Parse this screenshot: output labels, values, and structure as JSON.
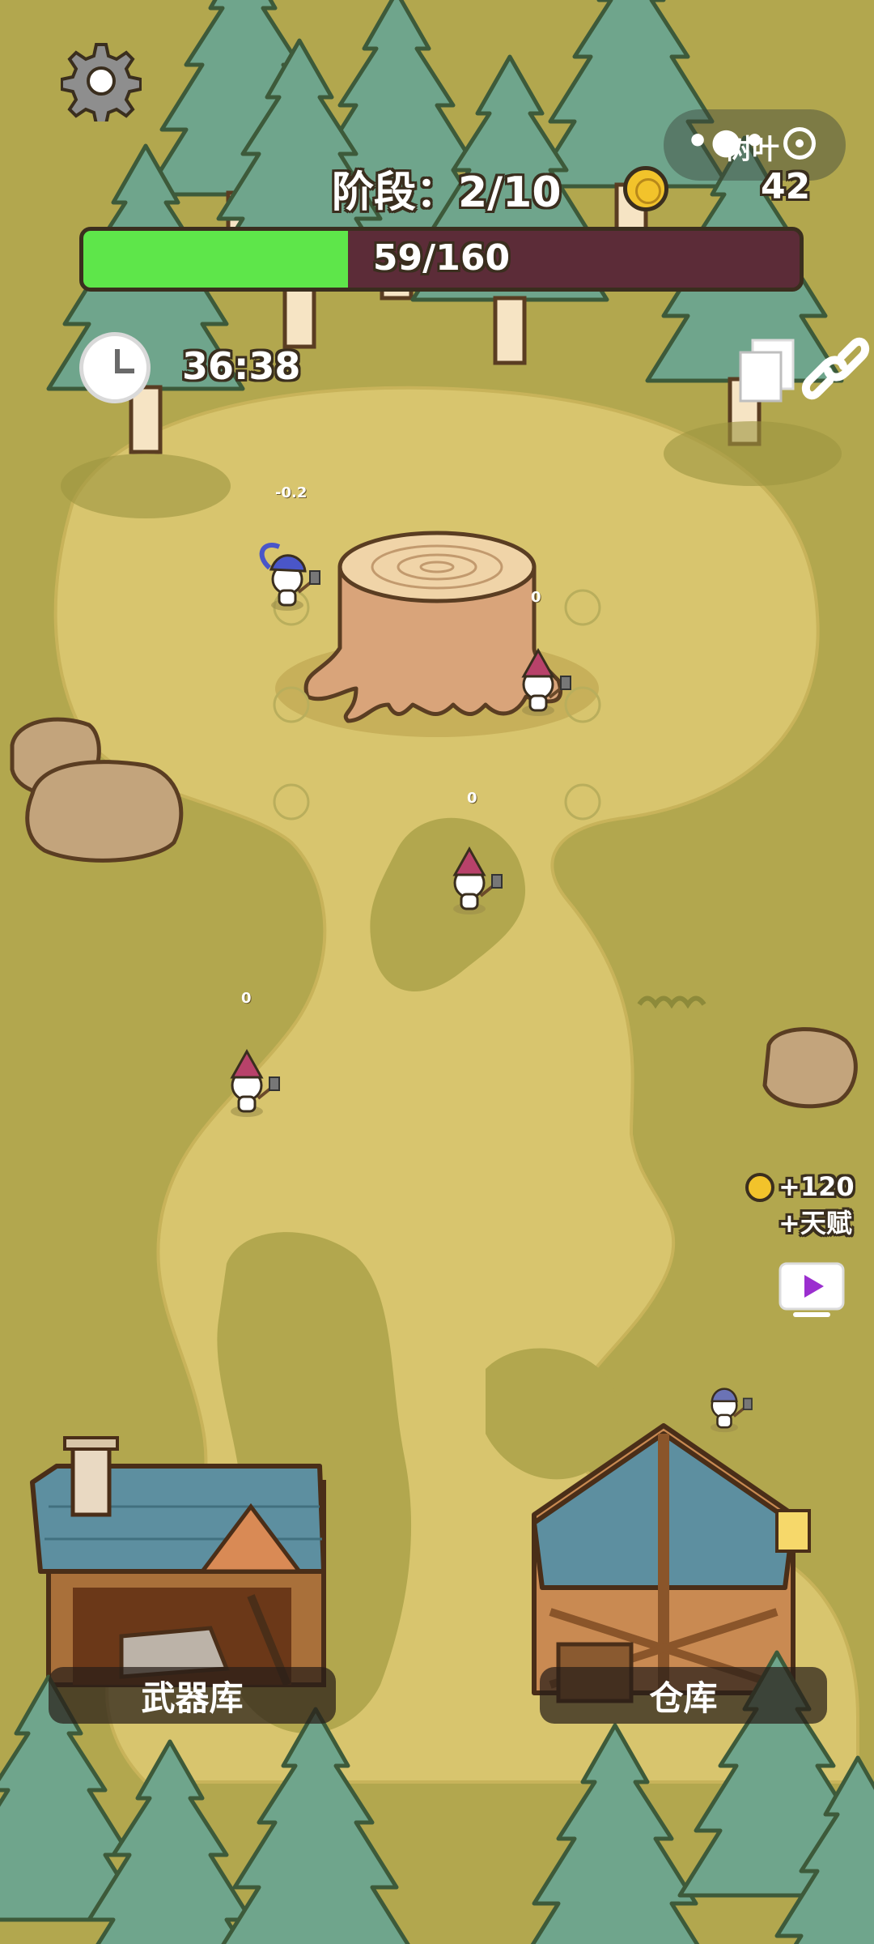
{
  "hud": {
    "stage_label": "阶段：2/10",
    "coin_count": "42",
    "progress_text": "59/160",
    "progress_fraction": 0.369,
    "timer": "36:38",
    "capsule_title": "树叶"
  },
  "floating_numbers": [
    "-0.2",
    "0",
    "0",
    "0"
  ],
  "reward": {
    "coins": "+120",
    "talent": "+天赋"
  },
  "buildings": {
    "armory_label": "武器库",
    "warehouse_label": "仓库"
  },
  "colors": {
    "grass": "#b2a74e",
    "path": "#d8c56e",
    "progress_fill": "#5ee64a",
    "progress_track": "#5c2c38",
    "tree": "#6fa58c",
    "trunk_outline": "#5a3d22"
  },
  "icons": [
    "gear-icon",
    "coin-icon",
    "clock-icon",
    "document-icon",
    "link-icon",
    "video-play-icon",
    "more-dots-icon",
    "target-icon"
  ]
}
